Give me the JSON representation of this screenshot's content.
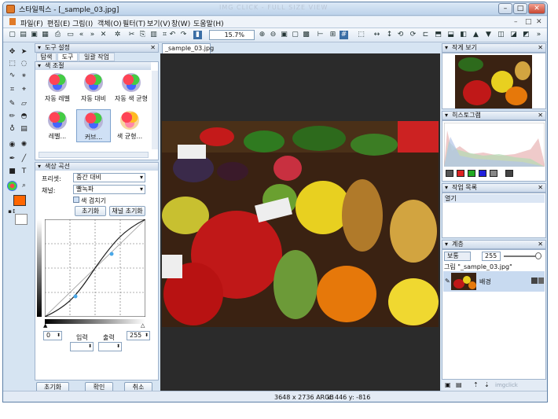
{
  "window": {
    "title": "스타일픽스 - [_sample_03.jpg]",
    "watermark": "IMG CLICK - FULL SIZE VIEW"
  },
  "menu": [
    "파일(F)",
    "편집(E)",
    "그림(I)",
    "객체(O)",
    "필터(T)",
    "보기(V)",
    "창(W)",
    "도움말(H)"
  ],
  "toolbar": {
    "zoom": "15.7%"
  },
  "tool_settings": {
    "header": "도구 설정",
    "tabs": [
      "탐색",
      "도구",
      "일괄 작업"
    ],
    "color_adjust_header": "색 조절",
    "tiles": [
      "자동 레벨",
      "자동 대비",
      "자동 색 균형",
      "레벨...",
      "커브...",
      "색 균형..."
    ]
  },
  "curves": {
    "header": "색상 곡선",
    "preset_label": "프리셋:",
    "preset_value": "중간 대비",
    "channel_label": "채널:",
    "channel_value": "빨녹파",
    "overlay_checkbox": "색 겹치기",
    "reset_button": "초기화",
    "reset_channel_button": "채널 초기화",
    "in_label": "입력",
    "out_label": "출력",
    "min_value": "0",
    "max_value": "255"
  },
  "bottom_buttons": [
    "초기화",
    "확인",
    "취소"
  ],
  "document": {
    "tab": "_sample_03.jpg"
  },
  "right_panels": {
    "thumbnail": "작게 보기",
    "histogram": "히스토그램",
    "history": "작업 목록",
    "history_item": "열기",
    "layers": "계층",
    "blend_mode": "보통",
    "opacity": "255",
    "group_name": "그림 \"_sample_03.jpg\"",
    "layer_name": "배경",
    "footer_watermark": "imgclick"
  },
  "status": {
    "size": "3648 x 2736 ARGB",
    "coords": "x: 446 y: -816"
  },
  "colors": {
    "accent": "#ff6600",
    "canvas": "#2b2b2b",
    "panel_bg": "#d6e4f2"
  }
}
